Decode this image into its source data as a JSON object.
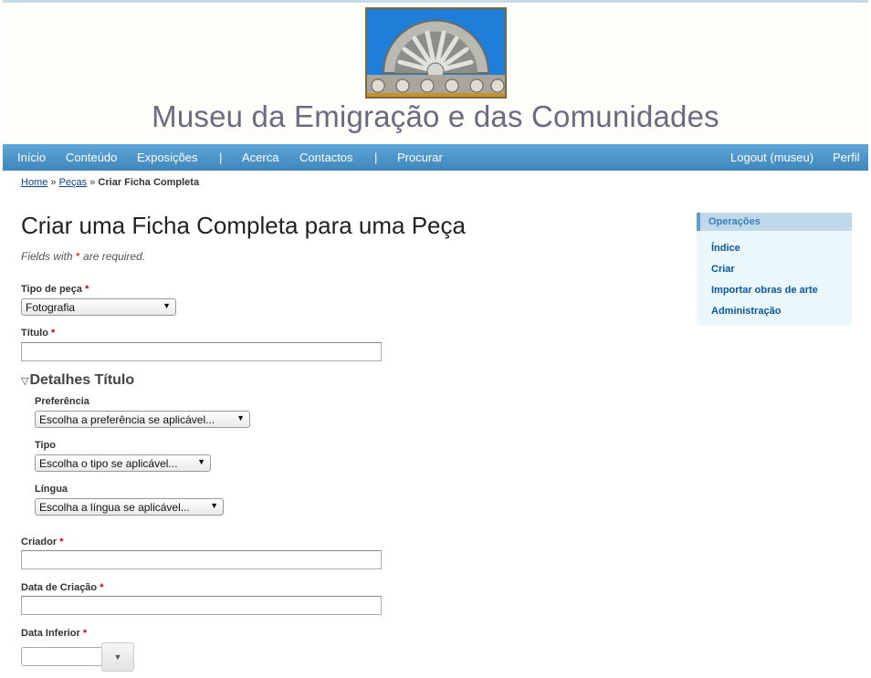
{
  "site": {
    "title": "Museu da Emigração e das Comunidades"
  },
  "menu": {
    "items": [
      "Início",
      "Conteúdo",
      "Exposições",
      "|",
      "Acerca",
      "Contactos",
      "|",
      "Procurar"
    ],
    "right_items": [
      "Logout (museu)",
      "Perfil"
    ]
  },
  "breadcrumb": {
    "home": "Home",
    "sep": "»",
    "section": "Peças",
    "current": "Criar Ficha Completa"
  },
  "page": {
    "title": "Criar uma Ficha Completa para uma Peça",
    "note_prefix": "Fields with",
    "note_star": "*",
    "note_suffix": "are required."
  },
  "form": {
    "required_mark": "*",
    "tipo_peca": {
      "label": "Tipo de peça",
      "value": "Fotografia"
    },
    "titulo": {
      "label": "Título",
      "value": ""
    },
    "detalhes_titulo": {
      "legend": "Detalhes Título",
      "preferencia": {
        "label": "Preferência",
        "value": "Escolha a preferência se aplicável..."
      },
      "tipo": {
        "label": "Tipo",
        "value": "Escolha o tipo se aplicável..."
      },
      "lingua": {
        "label": "Língua",
        "value": "Escolha a língua se aplicável..."
      }
    },
    "criador": {
      "label": "Criador",
      "value": ""
    },
    "data_criacao": {
      "label": "Data de Criação",
      "value": ""
    },
    "data_inferior": {
      "label": "Data Inferior",
      "value": ""
    }
  },
  "sidebar": {
    "title": "Operações",
    "items": [
      "Índice",
      "Criar",
      "Importar obras de arte",
      "Administração"
    ]
  },
  "colors": {
    "menu_bar": "#4a93c9",
    "title_text": "#6b6b80",
    "required": "#cc0000",
    "sidebar_bg": "#ebf8fb",
    "sidebar_link": "#0a55a0"
  }
}
